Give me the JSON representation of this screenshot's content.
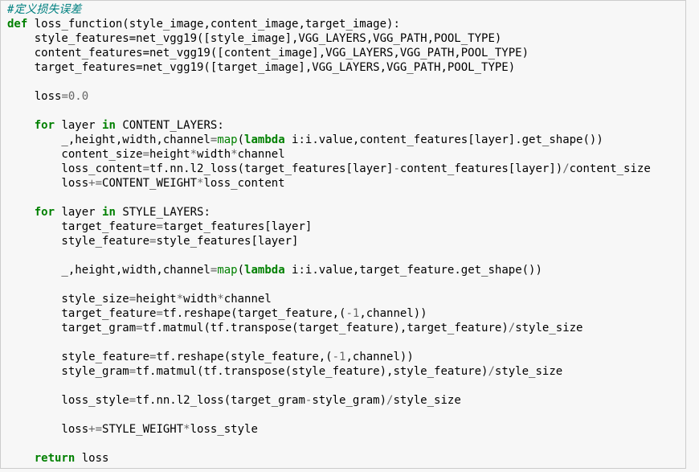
{
  "code": {
    "comment1": "#定义损失误差",
    "kw_def": "def",
    "fn_name": " loss_function(style_image,content_image,target_image):",
    "line_sf": "    style_features=net_vgg19([style_image],VGG_LAYERS,VGG_PATH,POOL_TYPE)",
    "line_cf": "    content_features=net_vgg19([content_image],VGG_LAYERS,VGG_PATH,POOL_TYPE)",
    "line_tf": "    target_features=net_vgg19([target_image],VGG_LAYERS,VGG_PATH,POOL_TYPE)",
    "loss_pre": "    loss",
    "op_eq": "=",
    "num_zero": "0.0",
    "kw_for1a": "for",
    "for1_mid": " layer ",
    "kw_in1": "in",
    "for1_tail": " CONTENT_LAYERS:",
    "l1a_pre": "        _,height,width,channel",
    "l1a_map": "map",
    "l1a_paren": "(",
    "l1a_lambda": "lambda",
    "l1a_tail": " i:i.value,content_features[layer].get_shape())",
    "l1b_pre": "        content_size",
    "l1b_a": "height",
    "op_mul": "*",
    "l1b_b": "width",
    "l1b_c": "channel",
    "l1c_pre": "        loss_content",
    "l1c_a": "tf.nn.l2_loss(target_features[layer]",
    "op_minus": "-",
    "l1c_b": "content_features[layer])",
    "op_div": "/",
    "l1c_c": "content_size",
    "l1d_pre": "        loss",
    "op_addeq": "+=",
    "l1d_a": "CONTENT_WEIGHT",
    "l1d_b": "loss_content",
    "kw_for2a": "for",
    "for2_mid": " layer ",
    "kw_in2": "in",
    "for2_tail": " STYLE_LAYERS:",
    "l2a_pre": "        target_feature",
    "l2a_tail": "target_features[layer]",
    "l2b_pre": "        style_feature",
    "l2b_tail": "style_features[layer]",
    "l2c_pre": "        _,height,width,channel",
    "l2c_map": "map",
    "l2c_paren": "(",
    "l2c_lambda": "lambda",
    "l2c_tail": " i:i.value,target_feature.get_shape())",
    "l2d_pre": "        style_size",
    "l2d_a": "height",
    "l2d_b": "width",
    "l2d_c": "channel",
    "l2e_pre": "        target_feature",
    "l2e_a": "tf.reshape(target_feature,(",
    "num_neg1a": "-1",
    "l2e_b": ",channel))",
    "l2f_pre": "        target_gram",
    "l2f_a": "tf.matmul(tf.transpose(target_feature),target_feature)",
    "l2f_b": "style_size",
    "l2g_pre": "        style_feature",
    "l2g_a": "tf.reshape(style_feature,(",
    "num_neg1b": "-1",
    "l2g_b": ",channel))",
    "l2h_pre": "        style_gram",
    "l2h_a": "tf.matmul(tf.transpose(style_feature),style_feature)",
    "l2h_b": "style_size",
    "l2i_pre": "        loss_style",
    "l2i_a": "tf.nn.l2_loss(target_gram",
    "l2i_b": "style_gram)",
    "l2i_c": "style_size",
    "l2j_pre": "        loss",
    "l2j_a": "STYLE_WEIGHT",
    "l2j_b": "loss_style",
    "kw_return": "return",
    "ret_tail": " loss"
  }
}
